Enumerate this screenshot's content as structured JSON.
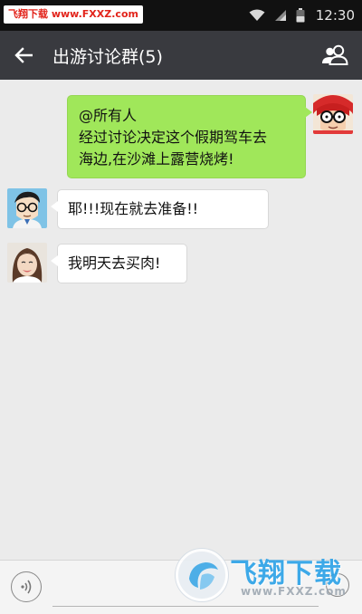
{
  "status_bar": {
    "watermark_text": "飞翔下载 www.FXXZ.com",
    "time": "12:30",
    "icons": [
      "wifi-icon",
      "signal-icon",
      "battery-icon"
    ]
  },
  "app_bar": {
    "title": "出游讨论群(5)",
    "back_icon": "arrow-left-icon",
    "members_icon": "group-members-icon",
    "background": "#393a3f"
  },
  "messages": [
    {
      "direction": "outgoing",
      "avatar": "cartoon-avatar-glasses-red",
      "lines": [
        "@所有人",
        "经过讨论决定这个假期驾车去",
        "海边,在沙滩上露营烧烤!"
      ]
    },
    {
      "direction": "incoming",
      "avatar": "cartoon-avatar-man-glasses",
      "lines": [
        "耶!!!现在就去准备!!"
      ]
    },
    {
      "direction": "incoming",
      "avatar": "photo-avatar-woman",
      "lines": [
        "我明天去买肉!"
      ]
    }
  ],
  "input_bar": {
    "voice_icon": "voice-input-icon",
    "text_value": "",
    "emoji_icon": "emoji-icon"
  },
  "brand_watermark": {
    "cn_text": "飞翔下载",
    "url_text": "www.FXXZ.com"
  },
  "colors": {
    "outgoing_bubble": "#a0e75a",
    "incoming_bubble": "#ffffff",
    "chat_background": "#ebebeb",
    "watermark_red": "#e2231a",
    "brand_blue": "#2ea3e8"
  }
}
